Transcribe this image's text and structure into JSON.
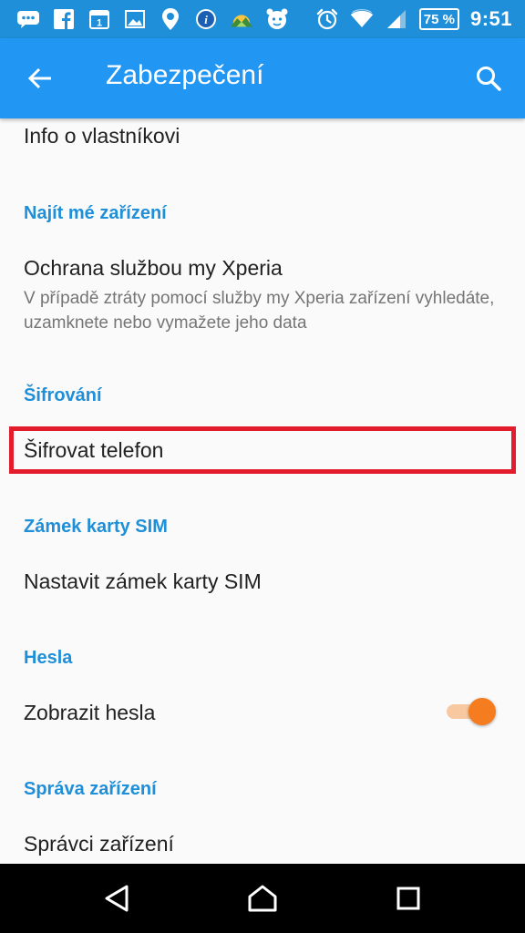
{
  "status_bar": {
    "icons": [
      "chat-icon",
      "facebook-icon",
      "calendar-icon",
      "image-icon",
      "location-pin-icon",
      "info-icon",
      "weather-icon",
      "alarm-app-icon",
      "alarm-clock-icon",
      "wifi-icon",
      "signal-icon"
    ],
    "calendar_day": "1",
    "battery": "75 %",
    "time": "9:51"
  },
  "toolbar": {
    "title": "Zabezpečení",
    "back_icon": "arrow-back-icon",
    "search_icon": "search-icon"
  },
  "settings": {
    "owner_info": {
      "title": "Info o vlastníkovi"
    },
    "find_device": {
      "header": "Najít mé zařízení",
      "xperia_title": "Ochrana službou my Xperia",
      "xperia_sub": "V případě ztráty pomocí služby my Xperia zařízení vyhledáte, uzamknete nebo vymažete jeho data"
    },
    "encryption": {
      "header": "Šifrování",
      "encrypt_title": "Šifrovat telefon"
    },
    "sim_lock": {
      "header": "Zámek karty SIM",
      "set_title": "Nastavit zámek karty SIM"
    },
    "passwords": {
      "header": "Hesla",
      "show_title": "Zobrazit hesla",
      "show_enabled": true
    },
    "device_admin": {
      "header": "Správa zařízení",
      "admins_title": "Správci zařízení"
    }
  },
  "nav_bar": {
    "back": "back-triangle-icon",
    "home": "home-icon",
    "recents": "recents-icon"
  },
  "colors": {
    "status_bar": "#1e8fd8",
    "toolbar": "#2196f3",
    "accent": "#1e8fd8",
    "highlight": "#e21b2d",
    "toggle": "#f57c1f"
  }
}
